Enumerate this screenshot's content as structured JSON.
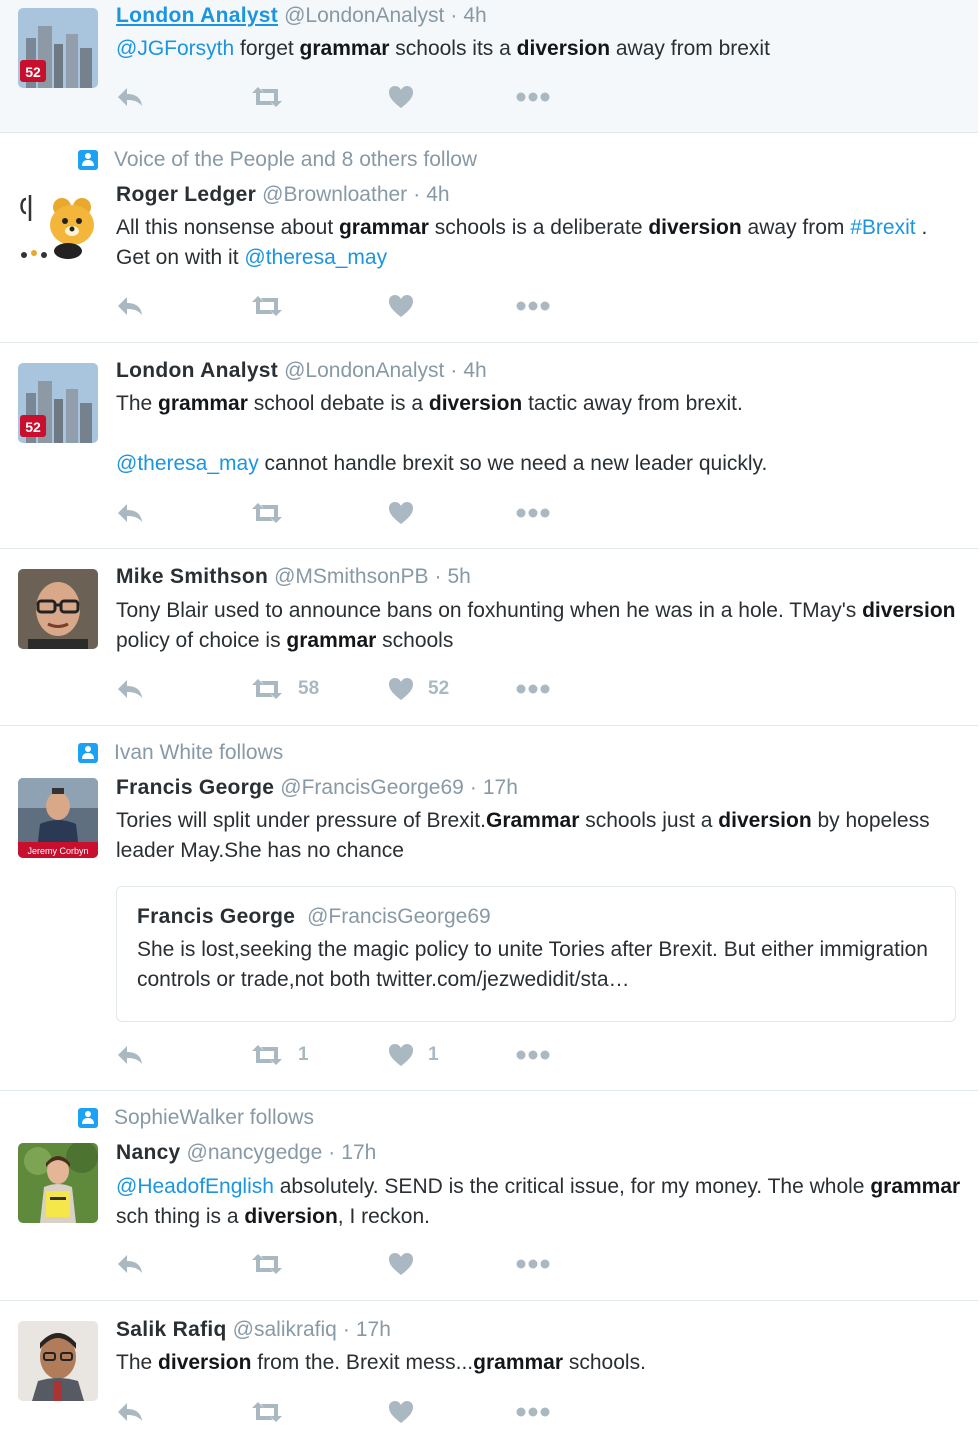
{
  "tweets": [
    {
      "context": "",
      "name": "London Analyst",
      "handle": "@LondonAnalyst",
      "time": "4h",
      "text_html": "<span class=\"link\">@JGForsyth</span> forget <b>grammar</b> schools its a <b>diversion</b> away from brexit",
      "retweets": "",
      "likes": ""
    },
    {
      "context": "Voice of the People and 8 others follow",
      "name": "Roger Ledger",
      "handle": "@Brownloather",
      "time": "4h",
      "text_html": "All this nonsense about <b>grammar</b> schools is a deliberate <b>diversion</b> away from <span class=\"link\">#Brexit</span> . Get on with it <span class=\"link\">@theresa_may</span>",
      "retweets": "",
      "likes": ""
    },
    {
      "context": "",
      "name": "London Analyst",
      "handle": "@LondonAnalyst",
      "time": "4h",
      "text_html": "The <b>grammar</b> school debate is a <b>diversion</b> tactic away from brexit.<br><br><span class=\"link\">@theresa_may</span> cannot handle brexit so we need a new leader quickly.",
      "retweets": "",
      "likes": ""
    },
    {
      "context": "",
      "name": "Mike Smithson",
      "handle": "@MSmithsonPB",
      "time": "5h",
      "text_html": "Tony Blair used to announce bans on foxhunting when he was in a hole. TMay's <b>diversion</b> policy of choice is <b>grammar</b> schools",
      "retweets": "58",
      "likes": "52"
    },
    {
      "context": "Ivan White follows",
      "name": "Francis George",
      "handle": "@FrancisGeorge69",
      "time": "17h",
      "text_html": "Tories will split under pressure of Brexit.<b>Grammar</b> schools just a <b>diversion</b> by hopeless leader May.She has no chance",
      "quote": {
        "name": "Francis George",
        "handle": "@FrancisGeorge69",
        "text": "She is lost,seeking the magic policy to unite Tories after Brexit. But either immigration controls or trade,not both twitter.com/jezwedidit/sta…"
      },
      "retweets": "1",
      "likes": "1"
    },
    {
      "context": "SophieWalker follows",
      "name": "Nancy",
      "handle": "@nancygedge",
      "time": "17h",
      "text_html": "<span class=\"link\">@HeadofEnglish</span> absolutely. SEND is the critical issue, for my money. The whole <b>grammar</b> sch thing is a <b>diversion</b>, I reckon.",
      "retweets": "",
      "likes": ""
    },
    {
      "context": "",
      "name": "Salik Rafiq",
      "handle": "@salikrafiq",
      "time": "17h",
      "text_html": "The <b>diversion</b> from the. Brexit mess...<b>grammar</b> schools.",
      "retweets": "",
      "likes": ""
    }
  ],
  "separator": "·",
  "icons": {
    "reply": "reply-icon",
    "retweet": "retweet-icon",
    "like": "heart-icon",
    "more": "more-dots-icon",
    "follow_context": "person-icon"
  },
  "colors": {
    "link": "#1b95e0",
    "muted": "#8899a6",
    "action": "#aab8c2",
    "context_icon": "#1da1f2",
    "highlight_bg": "#f5f8fa"
  }
}
